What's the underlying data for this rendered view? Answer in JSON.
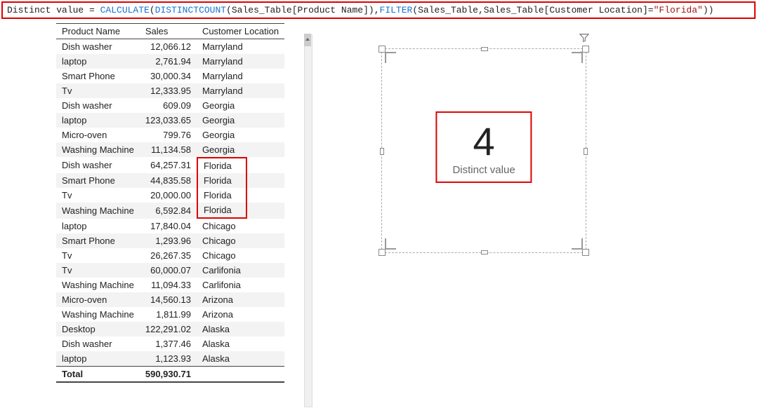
{
  "formula": {
    "measure_name": "Distinct value",
    "eq": " = ",
    "fn_calculate": "CALCULATE",
    "p1a": "(",
    "fn_distinctcount": "DISTINCTCOUNT",
    "p1b": "(Sales_Table[Product Name]),",
    "fn_filter": "FILTER",
    "p1c": "(Sales_Table,Sales_Table[Customer Location]=",
    "str": "\"Florida\"",
    "p1d": "))"
  },
  "table": {
    "headers": {
      "product": "Product Name",
      "sales": "Sales",
      "location": "Customer Location"
    },
    "rows": [
      {
        "p": "Dish washer",
        "s": "12,066.12",
        "l": "Marryland",
        "hl": false
      },
      {
        "p": "laptop",
        "s": "2,761.94",
        "l": "Marryland",
        "hl": false
      },
      {
        "p": "Smart Phone",
        "s": "30,000.34",
        "l": "Marryland",
        "hl": false
      },
      {
        "p": "Tv",
        "s": "12,333.95",
        "l": "Marryland",
        "hl": false
      },
      {
        "p": "Dish washer",
        "s": "609.09",
        "l": "Georgia",
        "hl": false
      },
      {
        "p": "laptop",
        "s": "123,033.65",
        "l": "Georgia",
        "hl": false
      },
      {
        "p": "Micro-oven",
        "s": "799.76",
        "l": "Georgia",
        "hl": false
      },
      {
        "p": "Washing Machine",
        "s": "11,134.58",
        "l": "Georgia",
        "hl": false
      },
      {
        "p": "Dish washer",
        "s": "64,257.31",
        "l": "Florida",
        "hl": true,
        "first": true
      },
      {
        "p": "Smart Phone",
        "s": "44,835.58",
        "l": "Florida",
        "hl": true
      },
      {
        "p": "Tv",
        "s": "20,000.00",
        "l": "Florida",
        "hl": true
      },
      {
        "p": "Washing Machine",
        "s": "6,592.84",
        "l": "Florida",
        "hl": true,
        "last": true
      },
      {
        "p": "laptop",
        "s": "17,840.04",
        "l": "Chicago",
        "hl": false
      },
      {
        "p": "Smart Phone",
        "s": "1,293.96",
        "l": "Chicago",
        "hl": false
      },
      {
        "p": "Tv",
        "s": "26,267.35",
        "l": "Chicago",
        "hl": false
      },
      {
        "p": "Tv",
        "s": "60,000.07",
        "l": "Carlifonia",
        "hl": false
      },
      {
        "p": "Washing Machine",
        "s": "11,094.33",
        "l": "Carlifonia",
        "hl": false
      },
      {
        "p": "Micro-oven",
        "s": "14,560.13",
        "l": "Arizona",
        "hl": false
      },
      {
        "p": "Washing Machine",
        "s": "1,811.99",
        "l": "Arizona",
        "hl": false
      },
      {
        "p": "Desktop",
        "s": "122,291.02",
        "l": "Alaska",
        "hl": false
      },
      {
        "p": "Dish washer",
        "s": "1,377.46",
        "l": "Alaska",
        "hl": false
      },
      {
        "p": "laptop",
        "s": "1,123.93",
        "l": "Alaska",
        "hl": false
      }
    ],
    "total_label": "Total",
    "total_value": "590,930.71"
  },
  "card": {
    "value": "4",
    "label": "Distinct value"
  },
  "tools": {
    "filter": "⌕",
    "more": "···"
  },
  "icons": {
    "funnel": "funnel"
  }
}
